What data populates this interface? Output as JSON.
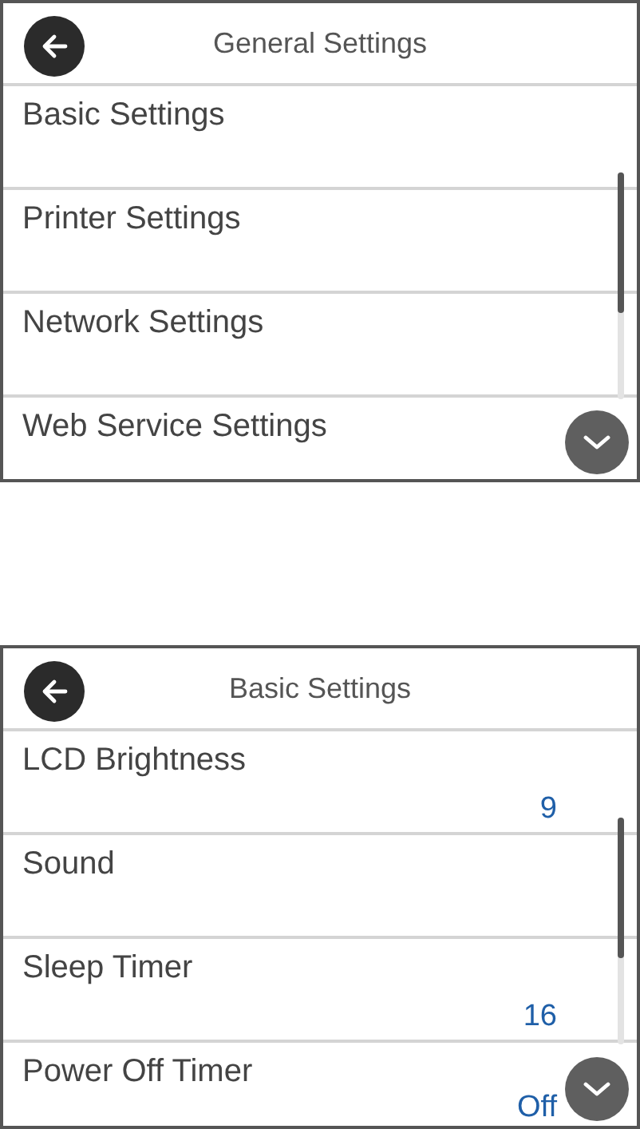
{
  "screens": [
    {
      "title": "General Settings",
      "items": [
        {
          "label": "Basic Settings"
        },
        {
          "label": "Printer Settings"
        },
        {
          "label": "Network Settings"
        },
        {
          "label": "Web Service Settings"
        }
      ]
    },
    {
      "title": "Basic Settings",
      "items": [
        {
          "label": "LCD Brightness",
          "value": "9"
        },
        {
          "label": "Sound"
        },
        {
          "label": "Sleep Timer",
          "value": "16"
        },
        {
          "label": "Power Off Timer",
          "value": "Off"
        }
      ]
    }
  ]
}
